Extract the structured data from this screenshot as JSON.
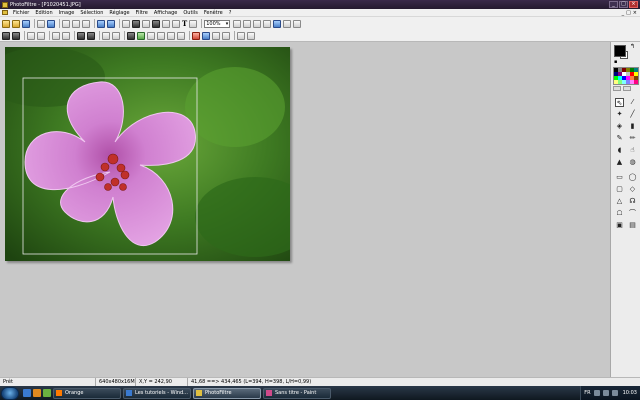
{
  "window": {
    "title": "PhotoFiltre - [P1020451.JPG]",
    "controls": [
      "_",
      "□",
      "×"
    ]
  },
  "menu": {
    "items": [
      "Fichier",
      "Edition",
      "Image",
      "Sélection",
      "Réglage",
      "Filtre",
      "Affichage",
      "Outils",
      "Fenêtre",
      "?"
    ]
  },
  "toolbar": {
    "zoom_value": "100%",
    "text_tool": "T"
  },
  "document": {
    "filename": "P1020451.JPG",
    "selection_shape": "rectangle"
  },
  "palette": {
    "foreground": "#000000",
    "background": "#ffffff",
    "swatches": [
      "#000000",
      "#808080",
      "#800000",
      "#808000",
      "#008000",
      "#008080",
      "#000080",
      "#800080",
      "#ffffff",
      "#c0c0c0",
      "#ff0000",
      "#ffff00",
      "#00ff00",
      "#00ffff",
      "#0000ff",
      "#ff00ff",
      "#ff8040",
      "#804000",
      "#ffff80",
      "#80ff80",
      "#80ffff",
      "#8080ff",
      "#ff80ff",
      "#ff0080"
    ]
  },
  "status": {
    "ready": "Prêt",
    "size": "640x480x16M",
    "coords": "X,Y = 242,90",
    "selection": "41,68 ==> 434,465 (L=394, H=398, L/H=0,99)"
  },
  "taskbar": {
    "tasks": [
      "Orange",
      "Les tutoriels - Wind...",
      "PhotoFiltre",
      "Sans titre - Paint"
    ],
    "active_task": 2,
    "lang": "FR",
    "time": "10:03"
  }
}
